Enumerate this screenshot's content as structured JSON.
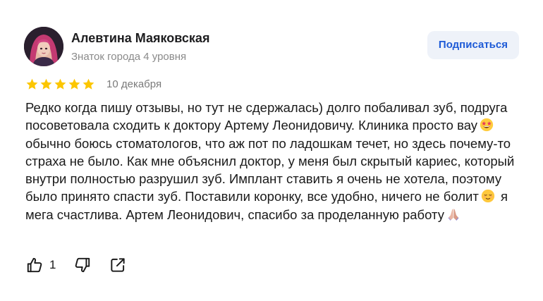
{
  "author": {
    "name": "Алевтина Маяковская",
    "level": "Знаток города 4 уровня"
  },
  "subscribe_label": "Подписаться",
  "rating": {
    "stars": 5,
    "max": 5
  },
  "date": "10 декабря",
  "review": {
    "p1": "Редко когда пишу отзывы, но тут не сдержалась) долго побаливал зуб, подруга посоветовала сходить к доктору Артему Леонидовичу. Клиника просто вау",
    "p2": "обычно боюсь стоматологов, что аж пот по ладошкам течет, но здесь почему-то страха не было. Как мне объяснил доктор, у меня был скрытый кариес, который внутри полностью разрушил зуб. Имплант ставить я очень не хотела, поэтому было принято спасти зуб. Поставили коронку, все удобно, ничего не болит",
    "p3": "я мега счастлива. Артем Леонидович, спасибо за проделанную работу"
  },
  "actions": {
    "likes": "1"
  },
  "colors": {
    "star": "#fcc600",
    "accent": "#1e5bd7",
    "subscribe_bg": "#eef2f9"
  },
  "icons": [
    "star-icon",
    "star-struck-emoji",
    "relieved-face-emoji",
    "folded-hands-emoji",
    "thumbs-up-icon",
    "thumbs-down-icon",
    "share-icon"
  ]
}
